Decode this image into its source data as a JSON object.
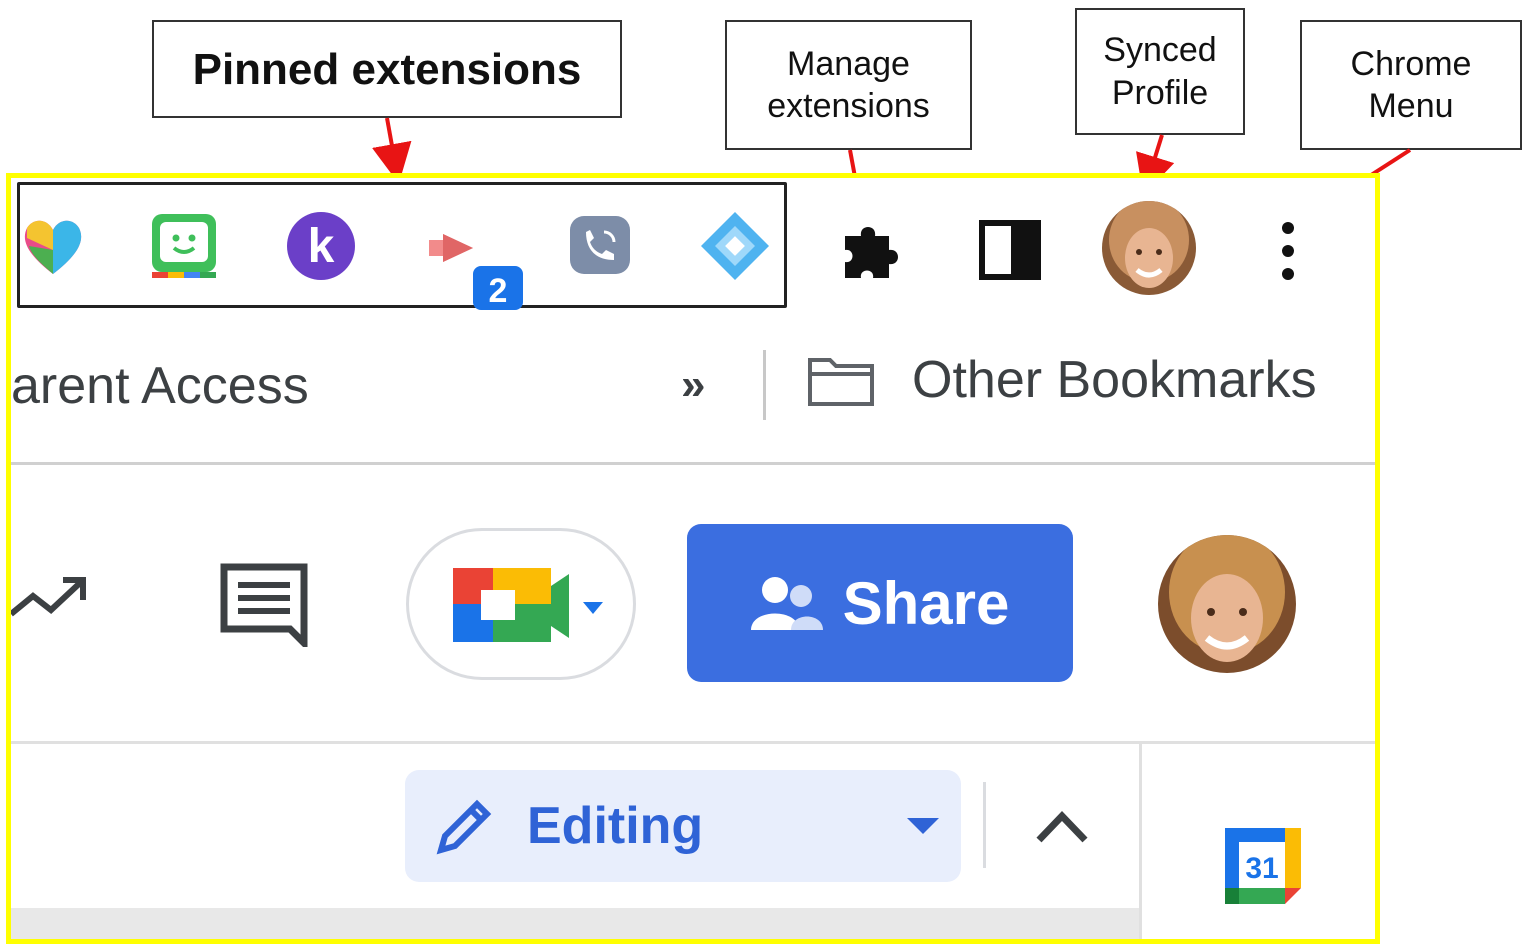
{
  "callouts": {
    "pinned_extensions": "Pinned extensions",
    "manage_extensions": [
      "Manage",
      "extensions"
    ],
    "synced_profile": [
      "Synced",
      "Profile"
    ],
    "chrome_menu": [
      "Chrome",
      "Menu"
    ]
  },
  "toolbar": {
    "pinned_extension_icons": [
      "heart-extension-icon",
      "bitmoji-extension-icon",
      "kami-extension-icon",
      "screencastify-extension-icon",
      "voice-extension-icon",
      "diamond-extension-icon"
    ],
    "screencastify_badge": "2",
    "manage_extensions_icon": "puzzle-icon",
    "side_panel_icon": "side-panel-icon",
    "profile_icon": "avatar",
    "menu_icon": "three-dot-menu-icon"
  },
  "bookmarks": {
    "partial_label": "arent Access",
    "overflow": "»",
    "other_bookmarks": "Other Bookmarks"
  },
  "docs_header": {
    "share_label": "Share",
    "editing_label": "Editing",
    "calendar_day": "31"
  },
  "colors": {
    "highlight": "#ffff00",
    "arrow": "#e81414",
    "share_blue": "#3b6ee0",
    "editing_bg": "#e8eefc",
    "editing_text": "#2f63d6"
  }
}
